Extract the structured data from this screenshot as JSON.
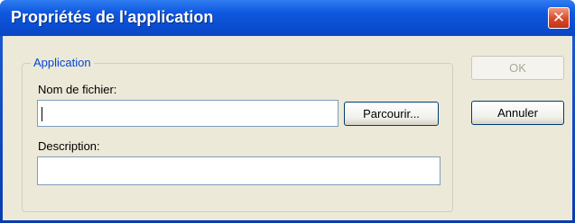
{
  "window": {
    "title": "Propriétés de l'application",
    "close_glyph": "✕"
  },
  "group": {
    "legend": "Application",
    "filename_label": "Nom de fichier:",
    "filename_value": "",
    "browse_label": "Parcourir...",
    "description_label": "Description:",
    "description_value": ""
  },
  "buttons": {
    "ok_label": "OK",
    "ok_enabled": false,
    "cancel_label": "Annuler"
  },
  "colors": {
    "titlebar": "#0a4ed2",
    "client_bg": "#ece9d8",
    "group_legend": "#0046d5",
    "close_button": "#d8472a"
  }
}
